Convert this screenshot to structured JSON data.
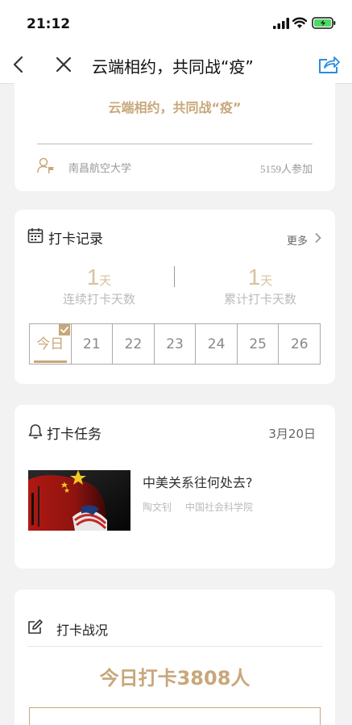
{
  "status_bar": {
    "time": "21:12"
  },
  "nav": {
    "title": "云端相约，共同战“疫”"
  },
  "top_card": {
    "slogan": "云端相约，共同战“疫”",
    "school": "南昌航空大学",
    "participants": "5159人参加"
  },
  "record": {
    "title": "打卡记录",
    "more": "更多",
    "consecutive": {
      "value": "1",
      "unit": "天",
      "label": "连续打卡天数"
    },
    "total": {
      "value": "1",
      "unit": "天",
      "label": "累计打卡天数"
    },
    "days": [
      "今日",
      "21",
      "22",
      "23",
      "24",
      "25",
      "26"
    ]
  },
  "task": {
    "title": "打卡任务",
    "date": "3月20日",
    "item": {
      "title": "中美关系往何处去?",
      "author": "陶文钊",
      "org": "中国社会科学院"
    }
  },
  "battle": {
    "title": "打卡战况",
    "today_count": "今日打卡3808人"
  },
  "colors": {
    "accent": "#c8a77a",
    "share_blue": "#2b8ce0"
  }
}
